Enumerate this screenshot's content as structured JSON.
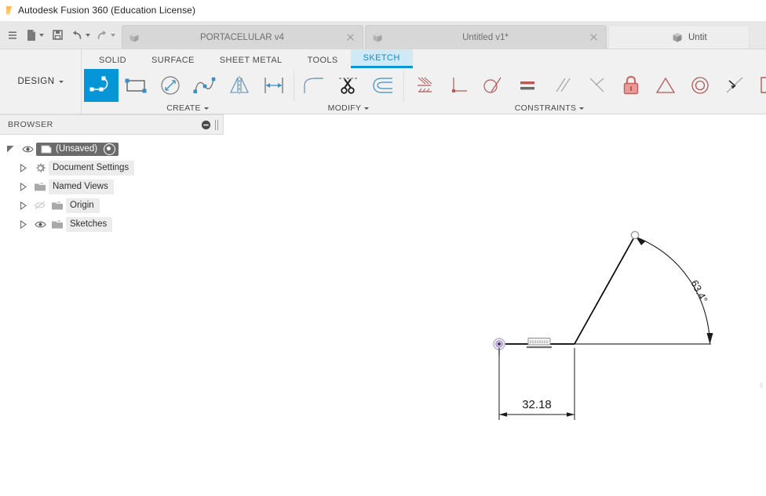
{
  "window": {
    "title": "Autodesk Fusion 360 (Education License)",
    "app_icon": "fusion-logo-icon"
  },
  "quick_access": {
    "items": [
      {
        "name": "app-menu",
        "icon": "hamburger-icon",
        "label": ""
      },
      {
        "name": "new-document",
        "icon": "file-icon",
        "label": ""
      },
      {
        "name": "save",
        "icon": "save-icon",
        "label": ""
      },
      {
        "name": "undo",
        "icon": "undo-arrow-icon",
        "label": ""
      },
      {
        "name": "redo",
        "icon": "redo-arrow-icon",
        "label": ""
      }
    ]
  },
  "document_tabs": [
    {
      "label": "PORTACELULAR v4",
      "icon": "cube-icon",
      "active": false,
      "closeable": true
    },
    {
      "label": "Untitled v1*",
      "icon": "cube-icon",
      "active": false,
      "closeable": true
    },
    {
      "label": "Untit",
      "icon": "cube-icon",
      "active": true,
      "closeable": false
    }
  ],
  "workspace": {
    "label": "DESIGN",
    "dropdown_icon": "chevron-down-icon"
  },
  "ribbon": {
    "tabs": [
      {
        "label": "SOLID",
        "active": false
      },
      {
        "label": "SURFACE",
        "active": false
      },
      {
        "label": "SHEET METAL",
        "active": false
      },
      {
        "label": "TOOLS",
        "active": false
      },
      {
        "label": "SKETCH",
        "active": true
      }
    ],
    "accent_color": "#0696d7",
    "active_tab_bg": "#cfe9f7",
    "groups": [
      {
        "caption": "CREATE",
        "has_dropdown": true,
        "tools": [
          {
            "name": "line-tool",
            "icon": "line-tool-icon",
            "selected": true
          },
          {
            "name": "rectangle-tool",
            "icon": "rectangle-icon",
            "selected": false
          },
          {
            "name": "circle-tool",
            "icon": "circle-diameter-icon",
            "selected": false
          },
          {
            "name": "spline-tool",
            "icon": "spline-icon",
            "selected": false
          },
          {
            "name": "mirror-tool",
            "icon": "mirror-icon",
            "selected": false
          },
          {
            "name": "sketch-dimension-tool",
            "icon": "dimension-icon",
            "selected": false
          }
        ]
      },
      {
        "caption": "MODIFY",
        "has_dropdown": true,
        "tools": [
          {
            "name": "fillet-tool",
            "icon": "fillet-icon",
            "selected": false
          },
          {
            "name": "trim-tool",
            "icon": "scissors-icon",
            "selected": false
          },
          {
            "name": "offset-tool",
            "icon": "offset-icon",
            "selected": false
          }
        ]
      },
      {
        "caption": "CONSTRAINTS",
        "has_dropdown": true,
        "tools": [
          {
            "name": "fix-unfix-constraint",
            "icon": "fix-constraint-icon",
            "selected": false
          },
          {
            "name": "perpendicular-constraint",
            "icon": "perpendicular-icon",
            "selected": false
          },
          {
            "name": "tangent-constraint",
            "icon": "tangent-icon",
            "selected": false
          },
          {
            "name": "equal-constraint",
            "icon": "equal-icon",
            "selected": false
          },
          {
            "name": "parallel-constraint",
            "icon": "parallel-icon",
            "selected": false
          },
          {
            "name": "coincident-constraint",
            "icon": "coincident-icon",
            "selected": false
          },
          {
            "name": "lock-constraint",
            "icon": "lock-icon",
            "selected": false
          },
          {
            "name": "symmetry-constraint",
            "icon": "triangle-symmetry-icon",
            "selected": false
          },
          {
            "name": "concentric-constraint",
            "icon": "concentric-circles-icon",
            "selected": false
          },
          {
            "name": "collinear-constraint",
            "icon": "collinear-icon",
            "selected": false
          },
          {
            "name": "midpoint-constraint",
            "icon": "midpoint-icon",
            "selected": false
          }
        ]
      }
    ]
  },
  "browser": {
    "title": "BROWSER",
    "collapse_icon": "minus-circle-icon",
    "resize_icon": "grip-handle-icon",
    "tree": [
      {
        "label": "(Unsaved)",
        "icon": "component-cube-icon",
        "visibility_icon": "eye-icon",
        "twist_icon": "triangle-expanded-icon",
        "selected": true,
        "has_radio": true,
        "indent": 0
      },
      {
        "label": "Document Settings",
        "icon": "gear-icon",
        "visibility_icon": "",
        "twist_icon": "triangle-collapsed-icon",
        "selected": false,
        "has_radio": false,
        "indent": 1
      },
      {
        "label": "Named Views",
        "icon": "folder-icon",
        "visibility_icon": "",
        "twist_icon": "triangle-collapsed-icon",
        "selected": false,
        "has_radio": false,
        "indent": 1
      },
      {
        "label": "Origin",
        "icon": "folder-icon",
        "visibility_icon": "eye-hidden-icon",
        "twist_icon": "triangle-collapsed-icon",
        "selected": false,
        "has_radio": false,
        "indent": 1
      },
      {
        "label": "Sketches",
        "icon": "folder-icon",
        "visibility_icon": "eye-icon",
        "twist_icon": "triangle-collapsed-icon",
        "selected": false,
        "has_radio": false,
        "indent": 1
      }
    ]
  },
  "canvas": {
    "origin_point": {
      "name": "sketch-origin-marker",
      "color": "#6b4fa0"
    },
    "sketch": {
      "linear_dimension": {
        "value": "32.18",
        "name": "linear-dimension-32-18"
      },
      "angular_dimension": {
        "value": "63.4°",
        "name": "angular-dimension-63-4"
      },
      "constraints": [
        {
          "name": "horizontal-constraint-glyph",
          "icon": "horizontal-constraint-icon"
        }
      ],
      "geometry_color": "#000000"
    }
  }
}
